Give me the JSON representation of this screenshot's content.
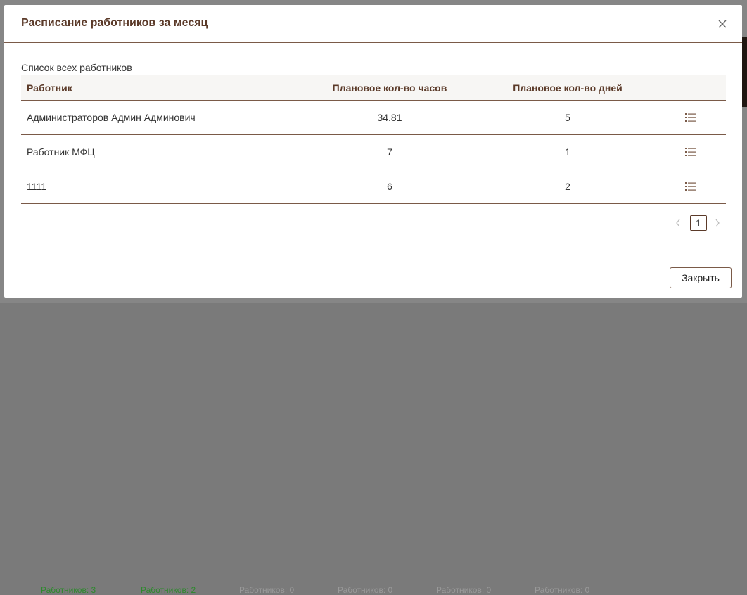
{
  "modal": {
    "title": "Расписание работников за месяц",
    "section_label": "Список всех работников",
    "close_button_label": "Закрыть",
    "close_icon": "close-icon"
  },
  "table": {
    "headers": [
      "Работник",
      "Плановое кол-во часов",
      "Плановое кол-во дней"
    ],
    "rows": [
      {
        "name": "Администраторов Админ Админович",
        "hours": "34.81",
        "days": "5",
        "action_icon": "list-icon"
      },
      {
        "name": "Работник МФЦ",
        "hours": "7",
        "days": "1",
        "action_icon": "list-icon"
      },
      {
        "name": "1111",
        "hours": "6",
        "days": "2",
        "action_icon": "list-icon"
      }
    ]
  },
  "pagination": {
    "current_page": "1"
  },
  "background": {
    "cells": [
      "Работников: 3",
      "Работников: 2",
      "Работников: 0",
      "Работников: 0",
      "Работников: 0",
      "Работников: 0"
    ]
  },
  "colors": {
    "accent": "#5b3a29",
    "divider": "#7a5a48",
    "icon": "#7a5a48"
  }
}
